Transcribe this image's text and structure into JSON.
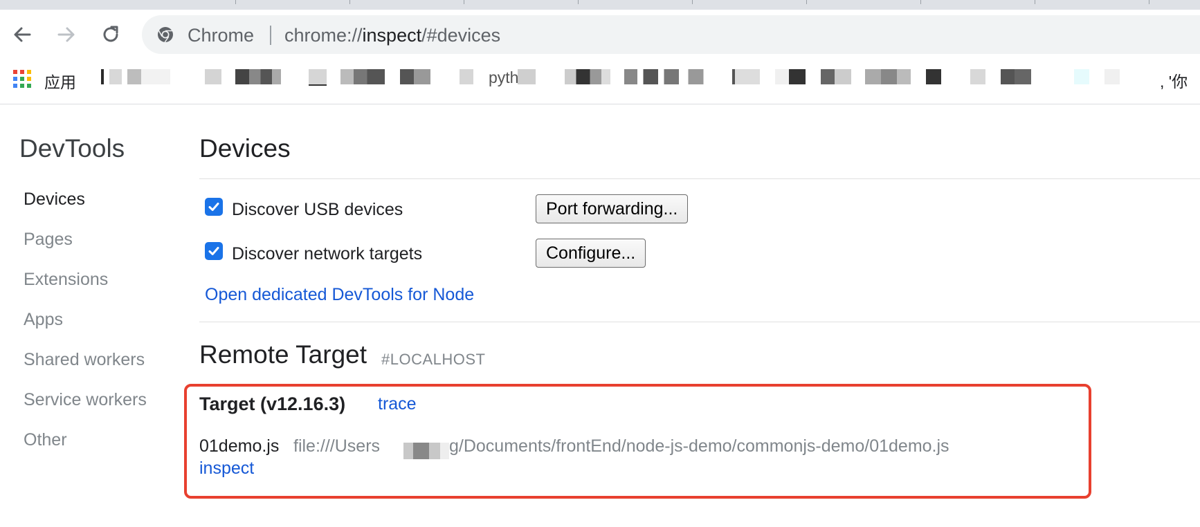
{
  "browser": {
    "omnibox": {
      "site_label": "Chrome",
      "url_scheme": "chrome://",
      "url_host": "inspect",
      "url_path": "/#devices"
    },
    "bookmarks": {
      "apps_label": "应用",
      "partial_texts": [
        "pyth",
        ", '你"
      ]
    }
  },
  "sidebar": {
    "title": "DevTools",
    "items": [
      {
        "label": "Devices",
        "selected": true
      },
      {
        "label": "Pages",
        "selected": false
      },
      {
        "label": "Extensions",
        "selected": false
      },
      {
        "label": "Apps",
        "selected": false
      },
      {
        "label": "Shared workers",
        "selected": false
      },
      {
        "label": "Service workers",
        "selected": false
      },
      {
        "label": "Other",
        "selected": false
      }
    ]
  },
  "main": {
    "title": "Devices",
    "discover_usb": {
      "label": "Discover USB devices",
      "checked": true,
      "button": "Port forwarding..."
    },
    "discover_network": {
      "label": "Discover network targets",
      "checked": true,
      "button": "Configure..."
    },
    "node_link": "Open dedicated DevTools for Node",
    "remote_target": {
      "title": "Remote Target",
      "subtitle": "#LOCALHOST",
      "target_name": "Target (v12.16.3)",
      "trace_link": "trace",
      "file_name": "01demo.js",
      "file_path_start": "file:///Users",
      "file_path_end": "g/Documents/frontEnd/node-js-demo/commonjs-demo/01demo.js",
      "inspect_link": "inspect"
    }
  },
  "colors": {
    "accent": "#1a73e8",
    "link": "#1558d6",
    "highlight_border": "#e8402f",
    "muted_text": "#80868b"
  },
  "icons": [
    "back-arrow-icon",
    "forward-arrow-icon",
    "reload-icon",
    "chrome-logo-icon",
    "apps-grid-icon",
    "checkmark-icon"
  ]
}
